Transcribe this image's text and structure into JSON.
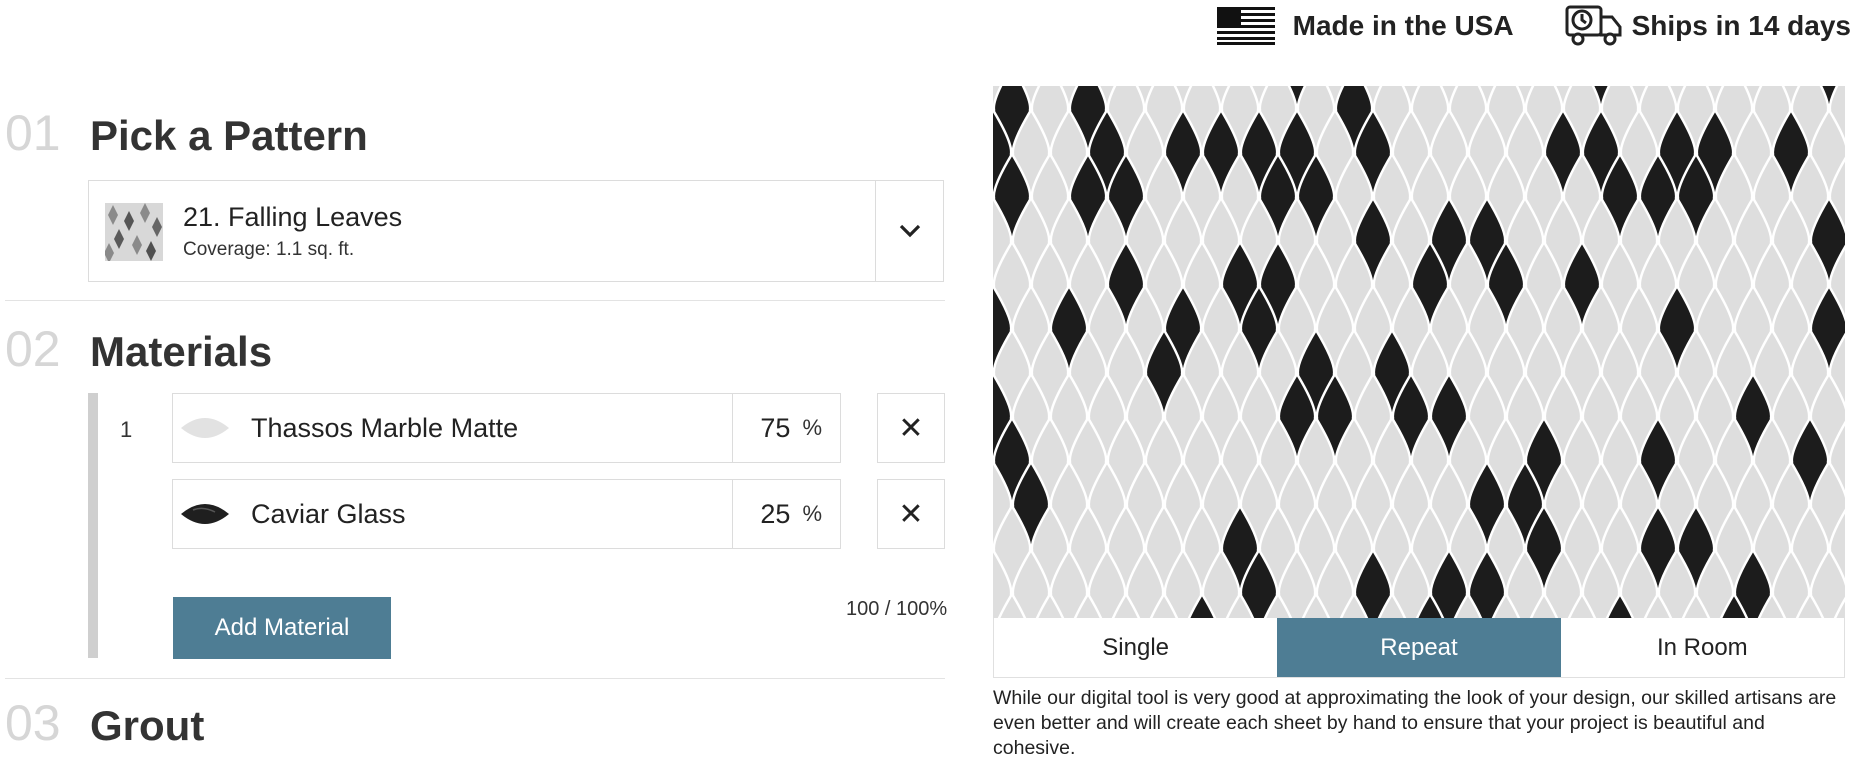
{
  "badges": {
    "usa_label": "Made in the USA",
    "shipping_label": "Ships in 14 days"
  },
  "steps": [
    {
      "number": "01",
      "title": "Pick a Pattern"
    },
    {
      "number": "02",
      "title": "Materials"
    },
    {
      "number": "03",
      "title": "Grout"
    }
  ],
  "pattern": {
    "name": "21. Falling Leaves",
    "coverage": "Coverage: 1.1 sq. ft.",
    "toggle_icon": "chevron-down-icon"
  },
  "materials": {
    "group_index": "1",
    "items": [
      {
        "name": "Thassos Marble Matte",
        "percent": "75",
        "percent_sign": "%",
        "swatch_color": "#e2e2e2",
        "remove_icon": "✕"
      },
      {
        "name": "Caviar Glass",
        "percent": "25",
        "percent_sign": "%",
        "swatch_color": "#1f1f1f",
        "remove_icon": "✕"
      }
    ],
    "add_label": "Add Material",
    "total": "100 / 100%"
  },
  "preview": {
    "tabs": [
      {
        "label": "Single",
        "active": false
      },
      {
        "label": "Repeat",
        "active": true
      },
      {
        "label": "In Room",
        "active": false
      }
    ],
    "disclaimer": "While our digital tool is very good at approximating the look of your design, our skilled artisans are even better and will create each sheet by hand to ensure that your project is beautiful and cohesive."
  },
  "colors": {
    "accent": "#4e7d94",
    "light_tile": "#dedede",
    "dark_tile": "#1c1c1c"
  }
}
